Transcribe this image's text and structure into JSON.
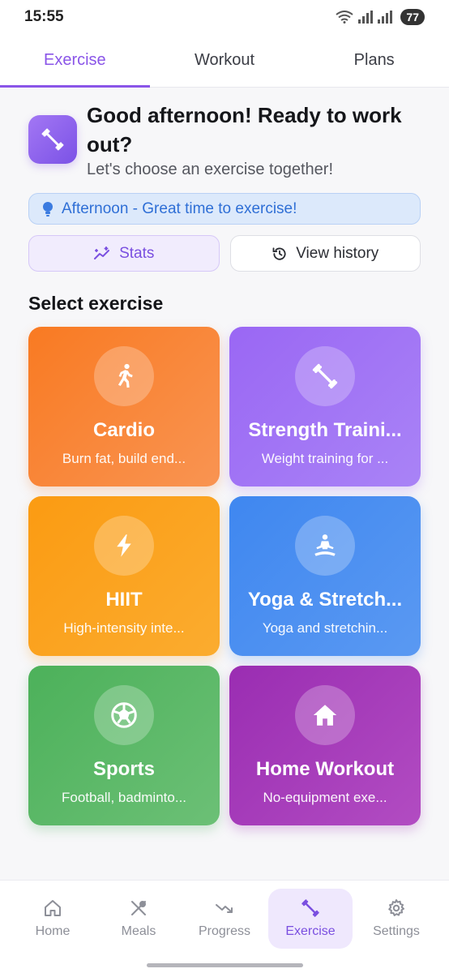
{
  "status_bar": {
    "time": "15:55",
    "battery": "77"
  },
  "top_tabs": [
    {
      "label": "Exercise",
      "active": true
    },
    {
      "label": "Workout",
      "active": false
    },
    {
      "label": "Plans",
      "active": false
    }
  ],
  "greeting": {
    "title": "Good afternoon! Ready to work out?",
    "subtitle": "Let's choose an exercise together!"
  },
  "tip": {
    "text": "Afternoon - Great time to exercise!"
  },
  "buttons": {
    "stats": "Stats",
    "history": "View history"
  },
  "section_title": "Select exercise",
  "cards": [
    {
      "title": "Cardio",
      "desc": "Burn fat, build end...",
      "icon": "running-icon"
    },
    {
      "title": "Strength Traini...",
      "desc": "Weight training for ...",
      "icon": "dumbbell-icon"
    },
    {
      "title": "HIIT",
      "desc": "High-intensity inte...",
      "icon": "lightning-icon"
    },
    {
      "title": "Yoga & Stretch...",
      "desc": "Yoga and stretchin...",
      "icon": "meditation-icon"
    },
    {
      "title": "Sports",
      "desc": "Football, badminto...",
      "icon": "soccer-ball-icon"
    },
    {
      "title": "Home Workout",
      "desc": "No-equipment exe...",
      "icon": "house-icon"
    }
  ],
  "bottom_nav": [
    {
      "label": "Home",
      "icon": "home-icon",
      "active": false
    },
    {
      "label": "Meals",
      "icon": "utensils-icon",
      "active": false
    },
    {
      "label": "Progress",
      "icon": "trend-icon",
      "active": false
    },
    {
      "label": "Exercise",
      "icon": "dumbbell-icon",
      "active": true
    },
    {
      "label": "Settings",
      "icon": "gear-icon",
      "active": false
    }
  ],
  "colors": {
    "accent": "#8a55e8",
    "cardio": "#f97a22",
    "strength": "#9a67f4",
    "hiit": "#fb9b12",
    "yoga": "#3f87f0",
    "sports": "#4cb15a",
    "home": "#9a2db2"
  }
}
